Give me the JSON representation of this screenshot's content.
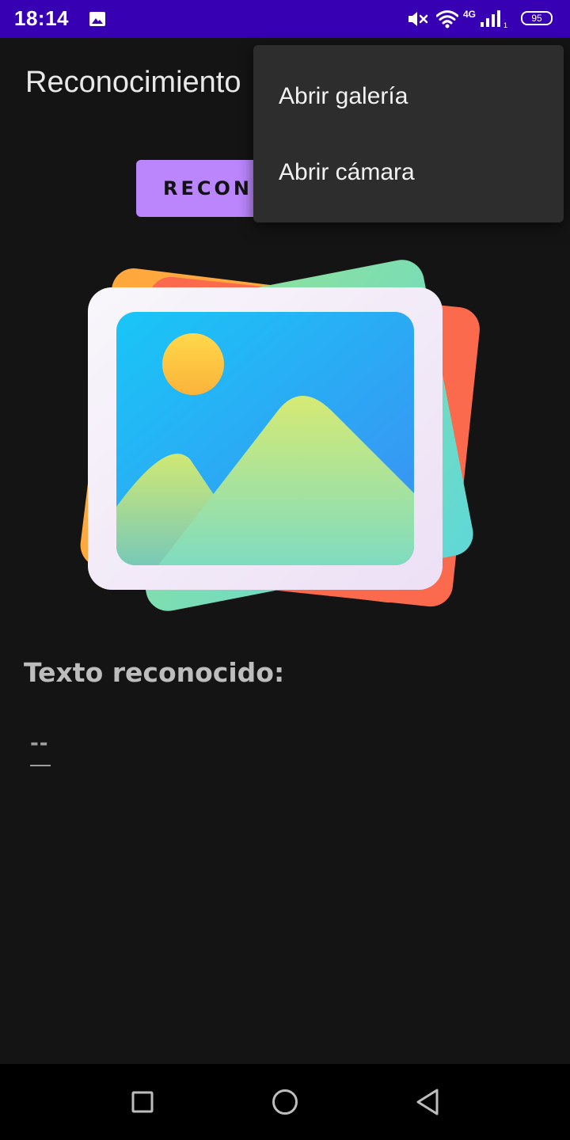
{
  "status_bar": {
    "time": "18:14",
    "network_type": "4G",
    "signal_sub": "1",
    "battery": "95",
    "icons": [
      "image-notification-icon",
      "mute-icon",
      "wifi-icon",
      "signal-icon",
      "battery-icon"
    ]
  },
  "app_bar": {
    "title": "Reconocimiento"
  },
  "main": {
    "recognize_button_label": "RECONOCER",
    "section_label": "Texto reconocido:",
    "result_text": "--",
    "illustration_icon": "image-gallery-icon"
  },
  "popup_menu": {
    "items": [
      {
        "label": "Abrir galería"
      },
      {
        "label": "Abrir cámara"
      }
    ]
  },
  "nav_bar": {
    "icons": [
      "recents-icon",
      "home-icon",
      "back-icon"
    ]
  },
  "colors": {
    "status_bar": "#3700b3",
    "background": "#141414",
    "button": "#bb86fc",
    "menu": "#2d2d2d"
  }
}
